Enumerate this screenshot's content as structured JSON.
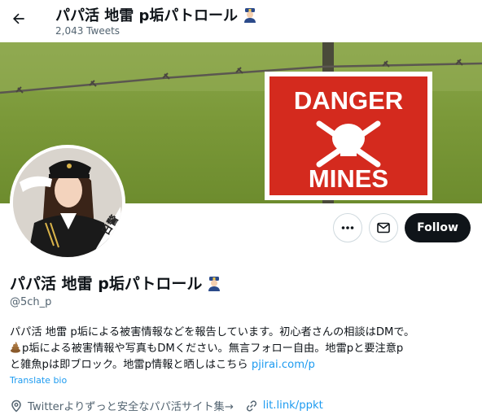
{
  "header": {
    "title": "パパ活 地雷 p垢パトロール",
    "tweet_count": "2,043 Tweets"
  },
  "banner": {
    "sign_line1": "DANGER",
    "sign_line2": "MINES"
  },
  "avatar": {
    "sash_text": "日警"
  },
  "actions": {
    "more_icon": "more-icon",
    "message_icon": "envelope-icon",
    "follow_label": "Follow"
  },
  "profile": {
    "name": "パパ活 地雷 p垢パトロール",
    "name_emoji": "police-officer-icon",
    "handle": "@5ch_p",
    "bio_line1": "パパ活 地雷 p垢による被害情報などを報告しています。初心者さんの相談はDMで。",
    "bio_line2": "p垢による被害情報や写真もDMください。無言フォロー自由。地雷pと要注意p",
    "bio_line3": "と雑魚pは即ブロック。地雷p情報と晒しはこちら ",
    "bio_link": "pjirai.com/p",
    "translate_label": "Translate bio",
    "location": "Twitterよりずっと安全なパパ活サイト集→",
    "website": "lit.link/ppkt"
  },
  "colors": {
    "accent": "#1d9bf0",
    "follow_bg": "#0f1419",
    "secondary_text": "#536471",
    "sign_red": "#d42a1e"
  }
}
